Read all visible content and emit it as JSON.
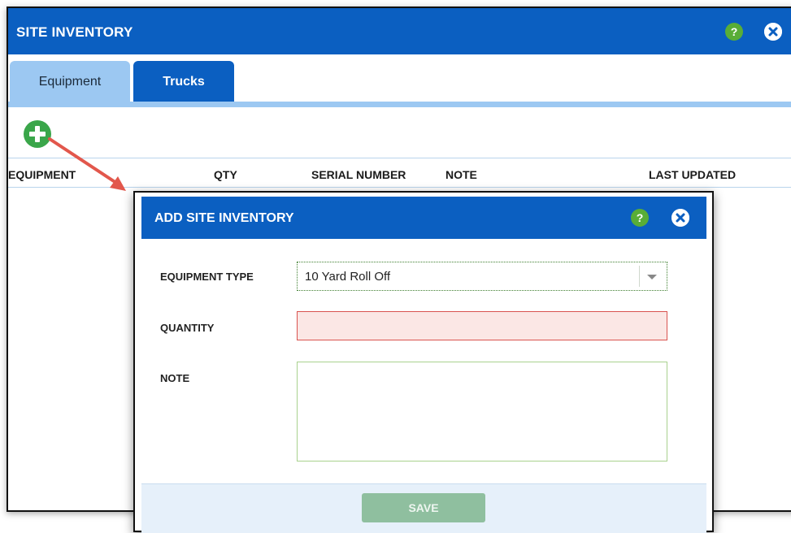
{
  "window": {
    "title": "SITE INVENTORY",
    "help_glyph": "?",
    "icons": {
      "help": "help-icon",
      "close": "close-icon"
    }
  },
  "tabs": [
    {
      "label": "Equipment",
      "active": true
    },
    {
      "label": "Trucks",
      "active": false
    }
  ],
  "toolbar": {
    "add_icon": "plus-circle-icon"
  },
  "table": {
    "columns": [
      "EQUIPMENT",
      "QTY",
      "SERIAL NUMBER",
      "NOTE",
      "LAST UPDATED"
    ]
  },
  "modal": {
    "title": "ADD SITE INVENTORY",
    "help_glyph": "?",
    "fields": {
      "equipment_type": {
        "label": "EQUIPMENT TYPE",
        "value": "10 Yard Roll Off"
      },
      "quantity": {
        "label": "QUANTITY",
        "value": ""
      },
      "note": {
        "label": "NOTE",
        "value": ""
      }
    },
    "save_label": "SAVE"
  },
  "colors": {
    "brand_blue": "#0b5fc1",
    "tab_light": "#9cc8f2",
    "help_green": "#59ad37",
    "add_green": "#3aa64a",
    "error_red": "#d9534f",
    "save_disabled": "#8fbf9f",
    "annotation_arrow": "#e2574c"
  }
}
